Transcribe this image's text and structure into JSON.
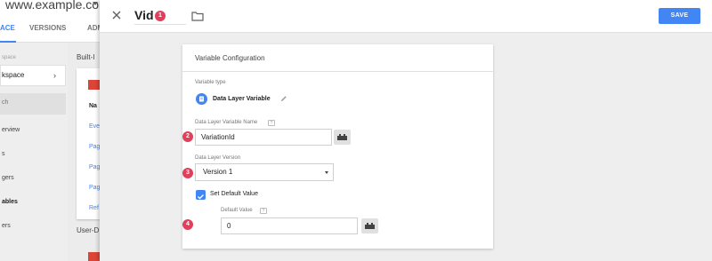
{
  "background_app": {
    "title": "www.example.com",
    "tabs": [
      "ACE",
      "VERSIONS",
      "ADM"
    ],
    "workspace_label": "space",
    "workspace_name": "kspace",
    "search_text": "ch",
    "nav_items": [
      "erview",
      "s",
      "gers",
      "ables",
      "ers"
    ],
    "section_builtin": "Built-I",
    "section_user": "User-D",
    "column_header": "Na",
    "links": [
      "Eve",
      "Pag",
      "Pag",
      "Pag",
      "Ref"
    ]
  },
  "panel": {
    "title": "Vid",
    "save_label": "SAVE"
  },
  "card": {
    "title": "Variable Configuration",
    "type_label": "Variable type",
    "type_name": "Data Layer Variable",
    "name_label": "Data Layer Variable Name",
    "name_value": "VariationId",
    "version_label": "Data Layer Version",
    "version_value": "Version 1",
    "default_checkbox_label": "Set Default Value",
    "default_checked": true,
    "default_label": "Default Value",
    "default_value": "0",
    "help_symbol": "?"
  },
  "badges": [
    "1",
    "2",
    "3",
    "4"
  ],
  "colors": {
    "accent": "#4285f4",
    "badge": "#e0405a",
    "danger": "#db4437"
  },
  "icons": {
    "close": "close-icon",
    "folder": "folder-icon",
    "edit": "pencil-icon",
    "variable": "lego-brick-icon",
    "variable_type": "data-layer-icon",
    "checkbox": "check-icon"
  }
}
